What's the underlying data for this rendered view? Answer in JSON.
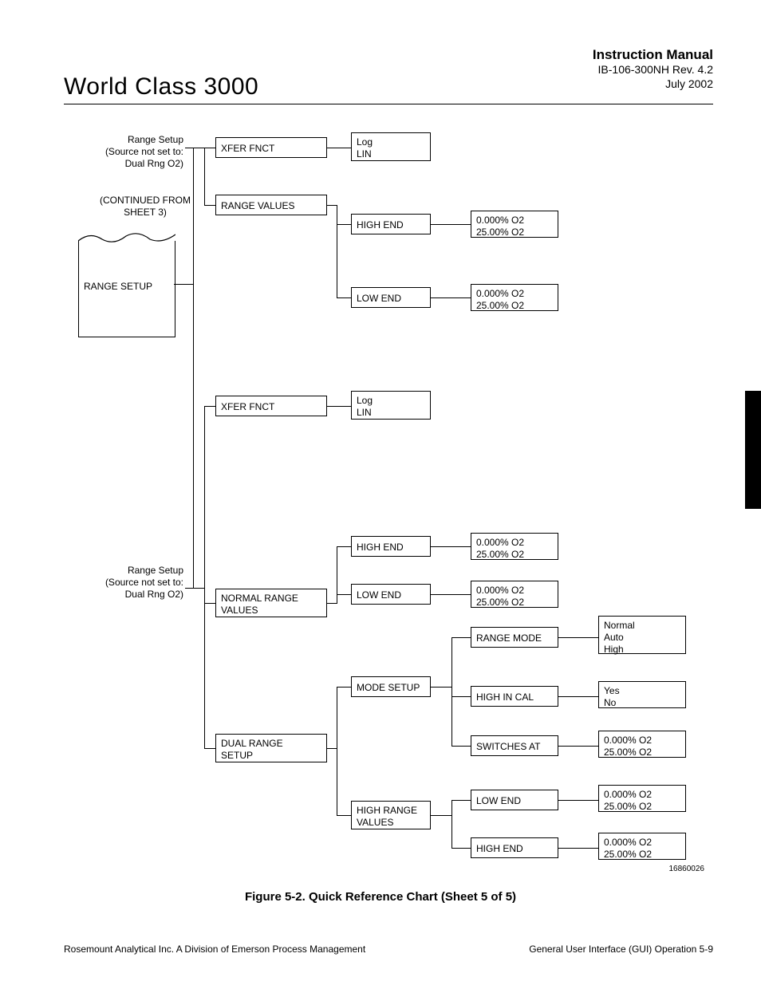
{
  "header": {
    "title": "World Class 3000",
    "manual": "Instruction Manual",
    "doc": "IB-106-300NH Rev. 4.2",
    "date": "July 2002"
  },
  "annot": {
    "range_setup_top": "Range Setup\n(Source not set to:\nDual Rng O2)",
    "continued": "(CONTINUED FROM\nSHEET 3)",
    "range_setup_bot": "Range Setup\n(Source not set to:\nDual Rng O2)"
  },
  "col0": {
    "range_setup": "RANGE SETUP"
  },
  "col1": {
    "xfer1": "XFER  FNCT",
    "range_values": "RANGE  VALUES",
    "xfer2": "XFER  FNCT",
    "normal_range": "NORMAL  RANGE\nVALUES",
    "dual_range": "DUAL  RANGE\nSETUP"
  },
  "col2": {
    "loglin1": "Log\nLIN",
    "high_end1": "HIGH  END",
    "low_end1": "LOW  END",
    "loglin2": "Log\nLIN",
    "high_end2": "HIGH  END",
    "low_end2": "LOW  END",
    "mode_setup": "MODE  SETUP",
    "high_range": "HIGH  RANGE\nVALUES"
  },
  "col3": {
    "o2a": "0.000%  O2\n25.00%  O2",
    "o2b": "0.000%  O2\n25.00%  O2",
    "o2c": "0.000%  O2\n25.00%  O2",
    "o2d": "0.000%  O2\n25.00%  O2",
    "range_mode": "RANGE  MODE",
    "high_in_cal": "HIGH  IN  CAL",
    "switches_at": "SWITCHES  AT",
    "low_end": "LOW  END",
    "high_end": "HIGH  END"
  },
  "col4": {
    "normal_auto_high": "Normal\nAuto\nHigh",
    "yesno": "Yes\nNo",
    "o2e": "0.000%  O2\n25.00%  O2",
    "o2f": "0.000%  O2\n25.00%  O2",
    "o2g": "0.000%  O2\n25.00%  O2"
  },
  "caption": "Figure 5-2.  Quick Reference Chart (Sheet 5 of 5)",
  "drawing_no": "16860026",
  "footer": {
    "left": "Rosemount Analytical Inc.    A Division of Emerson Process Management",
    "right": "General User Interface (GUI) Operation     5-9"
  }
}
